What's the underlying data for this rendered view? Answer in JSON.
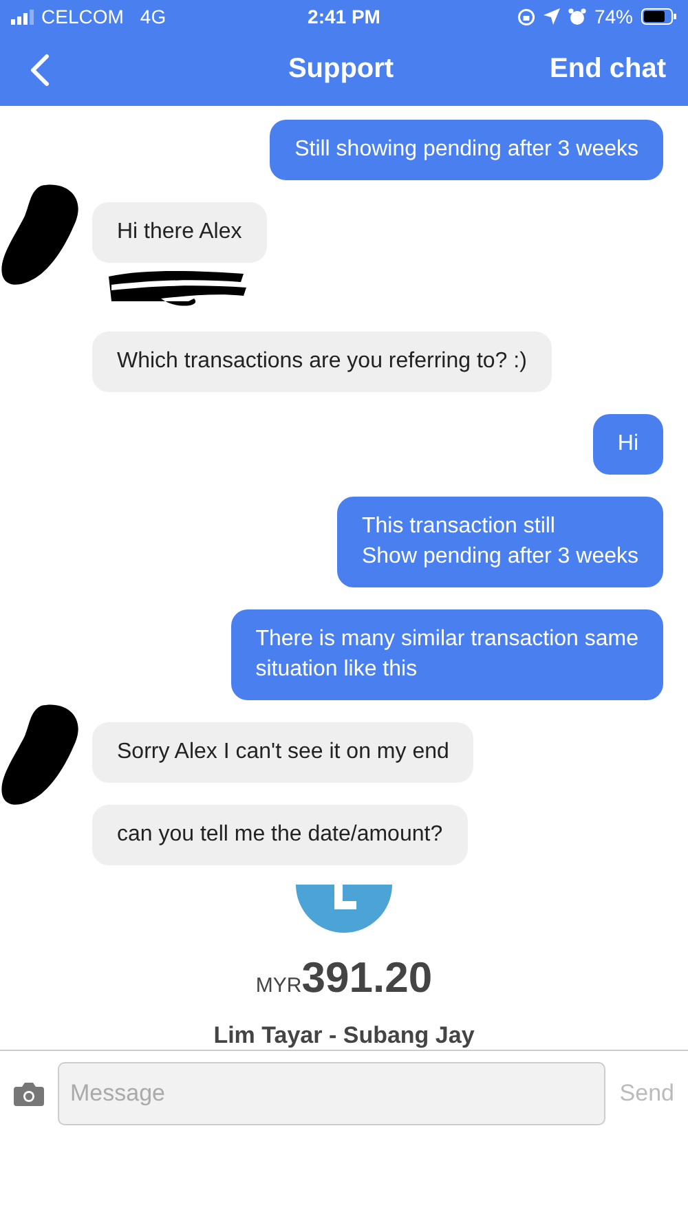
{
  "status_bar": {
    "carrier": "CELCOM",
    "network": "4G",
    "time": "2:41 PM",
    "battery": "74%"
  },
  "nav": {
    "title": "Support",
    "action": "End chat"
  },
  "messages": [
    {
      "kind": "me",
      "text": "Still showing pending after 3 weeks",
      "avatar_redacted": false,
      "name_redacted": false
    },
    {
      "kind": "agent",
      "text": "Hi there Alex",
      "avatar_redacted": true,
      "name_redacted": true
    },
    {
      "kind": "agent",
      "text": "Which transactions are you referring to? :)",
      "avatar_redacted": false,
      "name_redacted": false
    },
    {
      "kind": "me",
      "text": "Hi",
      "avatar_redacted": false,
      "name_redacted": false
    },
    {
      "kind": "me",
      "text": "This transaction still\nShow pending after 3 weeks",
      "avatar_redacted": false,
      "name_redacted": false
    },
    {
      "kind": "me",
      "text": "There is many similar transaction same\nsituation like this",
      "avatar_redacted": false,
      "name_redacted": false
    },
    {
      "kind": "agent",
      "text": "Sorry Alex I can't see it on my end",
      "avatar_redacted": true,
      "name_redacted": false
    },
    {
      "kind": "agent",
      "text": "can you tell me the date/amount?",
      "avatar_redacted": false,
      "name_redacted": false
    }
  ],
  "transaction": {
    "currency": "MYR",
    "amount": "391.20",
    "merchant": "Lim Tayar - Subang Jay"
  },
  "composer": {
    "placeholder": "Message",
    "send": {
      "label": "Send",
      "disabled": true
    }
  }
}
